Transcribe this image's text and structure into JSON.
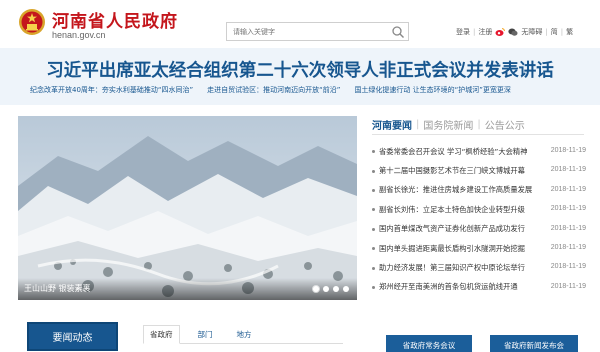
{
  "header": {
    "title": "河南省人民政府",
    "domain": "henan.gov.cn",
    "search_placeholder": "请输入关键字",
    "links": {
      "login": "登录",
      "register": "注册",
      "barrier_free": "无障碍",
      "simplified": "简",
      "traditional": "繁"
    },
    "social_icons": [
      "weibo-icon",
      "wechat-icon"
    ]
  },
  "headline": {
    "text": "习近平出席亚太经合组织第二十六次领导人非正式会议并发表讲话",
    "sublinks": [
      "纪念改革开放40周年：夯实水利基础推动“四水同治”",
      "走进自贸试验区：推动河南迈向开放“前沿”",
      "国土绿化提速行动 让生态环境的“护城河”更宽更深"
    ]
  },
  "photo": {
    "caption": "王山山野  银装素裹",
    "slide_count": 4
  },
  "news": {
    "tabs": [
      "河南要闻",
      "国务院新闻",
      "公告公示"
    ],
    "items": [
      {
        "title": "省委常委会召开会议 学习“枫桥经验”大会精神",
        "date": "2018-11-19"
      },
      {
        "title": "第十二届中国摄影艺术节在三门峡文博城开幕",
        "date": "2018-11-19"
      },
      {
        "title": "副省长徐光：推进住房城乡建设工作高质量发展",
        "date": "2018-11-19"
      },
      {
        "title": "副省长刘伟：立足本土特色加快企业转型升级",
        "date": "2018-11-19"
      },
      {
        "title": "国内首单煤改气资产证券化创新产品成功发行",
        "date": "2018-11-19"
      },
      {
        "title": "国内单头掘进距离最长盾构引水隧洞开始挖掘",
        "date": "2018-11-19"
      },
      {
        "title": "助力经济发展！第三届知识产权中原论坛举行",
        "date": "2018-11-19"
      },
      {
        "title": "郑州经开至南美洲的首条包机货运航线开通",
        "date": "2018-11-19"
      }
    ]
  },
  "bottom": {
    "main_button": "要闻动态",
    "tabs": [
      "省政府",
      "部门",
      "地方"
    ],
    "pill_meeting": "省政府常务会议",
    "pill_press": "省政府新闻发布会"
  },
  "colors": {
    "brand_red": "#c4161c",
    "brand_blue": "#17568f",
    "headline_bg": "#eef4fa"
  }
}
